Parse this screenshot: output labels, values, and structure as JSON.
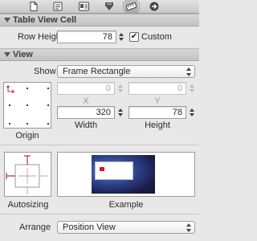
{
  "toolbar": {
    "tabs": [
      {
        "name": "file-inspector-icon",
        "glyph": "🗋"
      },
      {
        "name": "quick-help-icon",
        "glyph": "▤"
      },
      {
        "name": "identity-inspector-icon",
        "glyph": "▦"
      },
      {
        "name": "attributes-inspector-icon",
        "glyph": "⛉"
      },
      {
        "name": "size-inspector-icon",
        "glyph": "📏"
      },
      {
        "name": "connections-inspector-icon",
        "glyph": "➔"
      }
    ]
  },
  "table_view_cell": {
    "header": "Table View Cell",
    "row_height_label": "Row Height",
    "row_height_value": "78",
    "custom_label": "Custom",
    "custom_checked_glyph": "✔"
  },
  "view": {
    "header": "View",
    "show_label": "Show",
    "show_value": "Frame Rectangle",
    "x_value": "0",
    "y_value": "0",
    "x_label": "X",
    "y_label": "Y",
    "width_value": "320",
    "height_value": "78",
    "width_label": "Width",
    "height_label": "Height",
    "origin_label": "Origin",
    "autosizing_label": "Autosizing",
    "example_label": "Example",
    "arrange_label": "Arrange",
    "arrange_value": "Position View"
  },
  "colors": {
    "accent_red": "#d21d1d",
    "autosize_strut": "#b0303a"
  }
}
